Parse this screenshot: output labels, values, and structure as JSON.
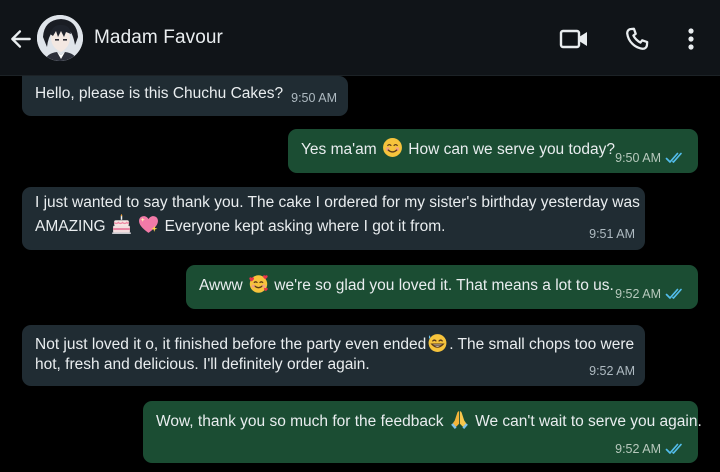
{
  "header": {
    "contact_name": "Madam Favour"
  },
  "icons": {
    "back": "arrow-left-icon",
    "avatar": "contact-avatar",
    "video": "video-camera-icon",
    "call": "phone-icon",
    "more": "more-vertical-icon",
    "read_receipt": "double-check-icon"
  },
  "colors": {
    "incoming_bubble": "#202c33",
    "outgoing_bubble": "#1b4d33",
    "read_tick": "#53bdeb",
    "background": "#000000"
  },
  "messages": [
    {
      "direction": "incoming",
      "lines": [
        "Hello, please is this Chuchu Cakes?"
      ],
      "time": "9:50 AM"
    },
    {
      "direction": "outgoing",
      "parts": [
        "Yes ma'am",
        "How can we serve you today?"
      ],
      "emojis": [
        "smiling-face-emoji"
      ],
      "time": "9:50 AM",
      "status": "read"
    },
    {
      "direction": "incoming",
      "line1": "I just wanted to say thank you. The cake I ordered for my sister's birthday yesterday was",
      "line2_start": "AMAZING",
      "line2_end": "Everyone kept asking where I got it from.",
      "emojis": [
        "birthday-cake-emoji",
        "sparkling-heart-emoji"
      ],
      "time": "9:51 AM"
    },
    {
      "direction": "outgoing",
      "parts": [
        "Awww",
        "we're so glad you loved it. That means a lot to us."
      ],
      "emojis": [
        "smiling-face-with-hearts-emoji"
      ],
      "time": "9:52 AM",
      "status": "read"
    },
    {
      "direction": "incoming",
      "line1_start": "Not just loved it o, it finished before the party even ended",
      "line1_end": ". The small chops too were",
      "line2": "hot, fresh and delicious. I'll definitely order again.",
      "emojis": [
        "grinning-sweat-emoji"
      ],
      "time": "9:52 AM"
    },
    {
      "direction": "outgoing",
      "parts": [
        "Wow, thank you so much for the feedback",
        "We can't wait to serve you again."
      ],
      "emojis": [
        "folded-hands-emoji"
      ],
      "time": "9:52 AM",
      "status": "read"
    }
  ]
}
